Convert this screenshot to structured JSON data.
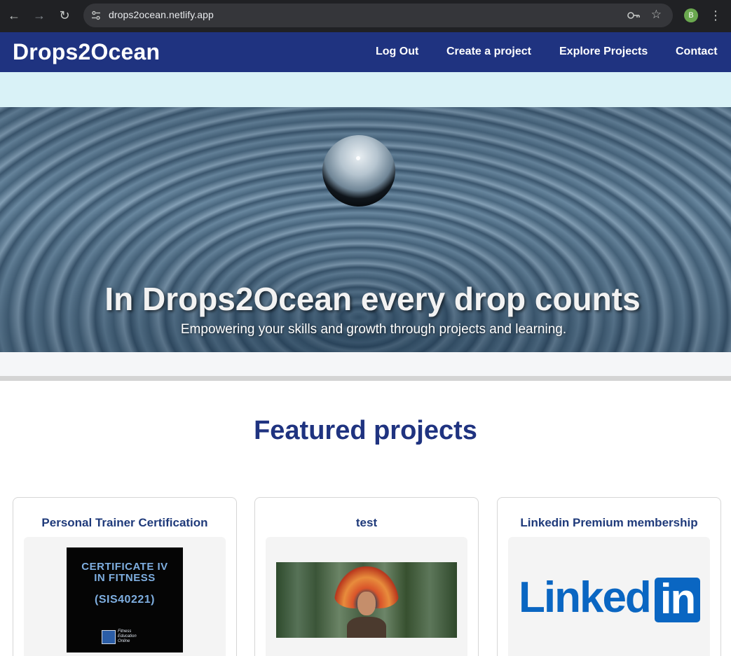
{
  "browser": {
    "url": "drops2ocean.netlify.app",
    "profile_initial": "B",
    "icons": [
      "back-icon",
      "forward-icon",
      "reload-icon",
      "site-settings-icon",
      "key-icon",
      "star-icon",
      "more-menu-icon"
    ]
  },
  "header": {
    "brand": "Drops2Ocean",
    "nav": [
      "Log Out",
      "Create a project",
      "Explore Projects",
      "Contact"
    ]
  },
  "hero": {
    "title": "In Drops2Ocean every drop counts",
    "subtitle": "Empowering your skills and growth through projects and learning."
  },
  "featured": {
    "heading": "Featured projects",
    "cards": [
      {
        "title": "Personal Trainer Certification",
        "image_text": [
          "CERTIFICATE IV",
          "IN FITNESS",
          "(SIS40221)",
          "Fitness",
          "Education",
          "Online"
        ]
      },
      {
        "title": "test"
      },
      {
        "title": "Linkedin Premium membership",
        "image_text": [
          "Linked",
          "in"
        ]
      }
    ]
  },
  "colors": {
    "brand_blue": "#1f3380",
    "strip": "#d9f2f7",
    "card_title": "#1f3a7a",
    "linkedin": "#0a66c2"
  }
}
